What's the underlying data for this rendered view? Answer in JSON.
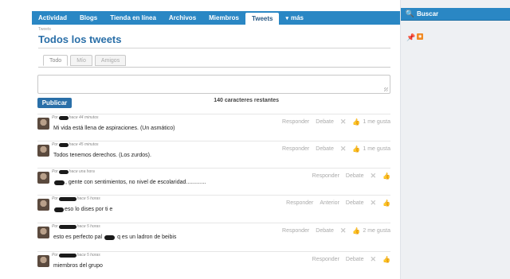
{
  "nav": {
    "items": [
      {
        "label": "Actividad"
      },
      {
        "label": "Blogs"
      },
      {
        "label": "Tienda en línea"
      },
      {
        "label": "Archivos"
      },
      {
        "label": "Miembros"
      },
      {
        "label": "Tweets",
        "active": true
      },
      {
        "label": "más"
      }
    ]
  },
  "search": {
    "label": "Buscar"
  },
  "page": {
    "breadcrumb": "Tweets",
    "title": "Todos los tweets"
  },
  "tabs": [
    {
      "label": "Todo",
      "active": true
    },
    {
      "label": "Mío"
    },
    {
      "label": "Amigos"
    }
  ],
  "composer": {
    "publish_label": "Publicar",
    "chars_remaining": "140 caracteres restantes"
  },
  "posts": [
    {
      "by": "Por",
      "time": "hace 44 minutos",
      "text": "Mi vida está llena de aspiraciones. (Un asmático)",
      "actions": [
        "Responder",
        "Debate"
      ],
      "likes": "1 me gusta"
    },
    {
      "by": "Por",
      "time": "hace 45 minutos",
      "text": "Todos tenemos derechos. (Los zurdos).",
      "actions": [
        "Responder",
        "Debate"
      ],
      "likes": "1 me gusta"
    },
    {
      "by": "Por",
      "time": "hace una hora",
      "text": ", gente con sentimientos, no nivel de escolaridad.............",
      "actions": [
        "Responder",
        "Debate"
      ],
      "likes": ""
    },
    {
      "by": "Por",
      "time": "hace 5 horas",
      "text": "eso lo dises por ti e",
      "actions": [
        "Responder",
        "Anterior",
        "Debate"
      ],
      "likes": ""
    },
    {
      "by": "Por",
      "time": "hace 5 horas",
      "text_before": "esto es perfecto pal",
      "text_after": "q es un ladron de beibis",
      "actions": [
        "Responder",
        "Debate"
      ],
      "likes": "2 me gusta"
    },
    {
      "by": "Por",
      "time": "hace 5 horas",
      "text": "miembros del grupo",
      "actions": [
        "Responder",
        "Debate"
      ],
      "likes": ""
    }
  ]
}
